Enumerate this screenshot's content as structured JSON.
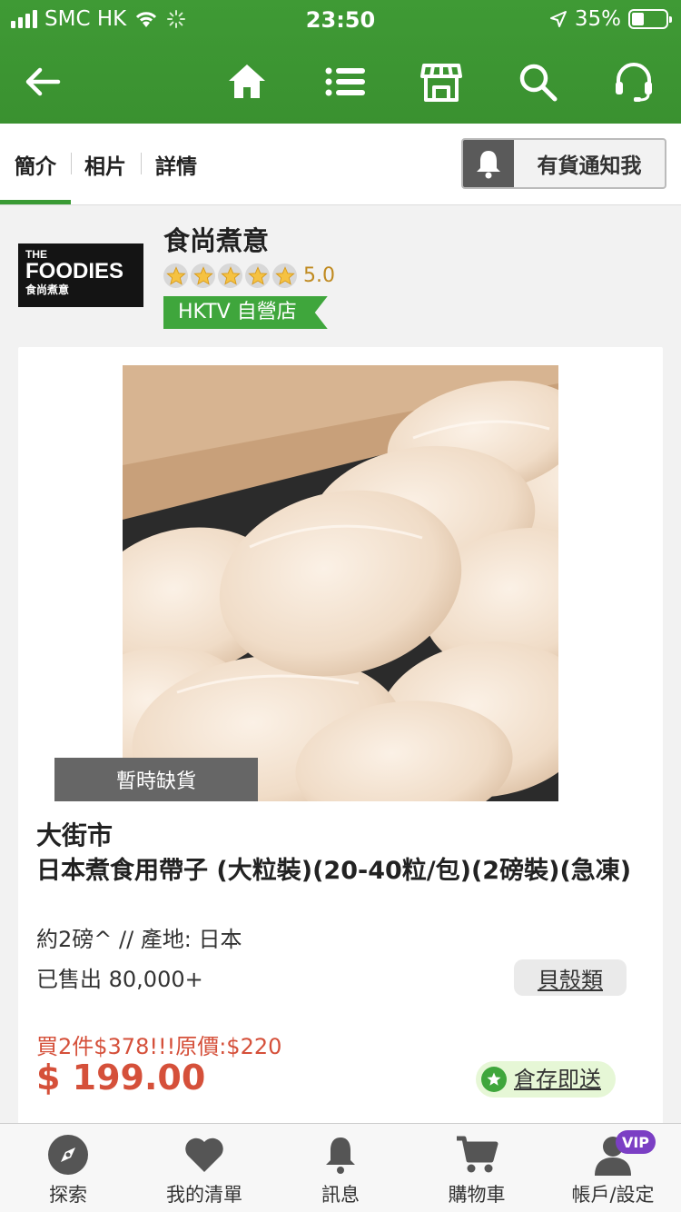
{
  "status_bar": {
    "carrier": "SMC HK",
    "time": "23:50",
    "battery": "35%",
    "battery_level": 0.35
  },
  "navbar": {
    "icons": [
      "back-arrow-icon",
      "home-icon",
      "list-icon",
      "store-icon",
      "search-icon",
      "headset-icon"
    ]
  },
  "tabs": {
    "items": [
      "簡介",
      "相片",
      "詳情"
    ],
    "active": "簡介",
    "notify_label": "有貨通知我"
  },
  "store": {
    "logo_line1": "THE",
    "logo_line2": "FOODIES",
    "logo_line3": "食尚煮意",
    "name": "食尚煮意",
    "rating": "5.0",
    "tag": "HKTV 自營店"
  },
  "product": {
    "sold_out_label": "暫時缺貨",
    "brand": "大街市",
    "title": "日本煮食用帶子 (大粒裝)(20-40粒/包)(2磅裝)(急凍)",
    "spec": "約2磅^ // 產地: 日本",
    "sold": "已售出 80,000+",
    "category": "貝殼類",
    "promo": "買2件$378!!!原價:$220",
    "price": "$ 199.00",
    "delivery": "倉存即送"
  },
  "bottom_nav": {
    "items": [
      {
        "label": "探索",
        "icon": "compass-icon"
      },
      {
        "label": "我的清單",
        "icon": "heart-icon"
      },
      {
        "label": "訊息",
        "icon": "bell-icon"
      },
      {
        "label": "購物車",
        "icon": "cart-icon"
      },
      {
        "label": "帳戶/設定",
        "icon": "account-icon"
      }
    ],
    "vip_badge": "VIP"
  },
  "colors": {
    "brand_green": "#3a9a34",
    "price_red": "#d5503a",
    "vip_purple": "#7b3fc4"
  }
}
